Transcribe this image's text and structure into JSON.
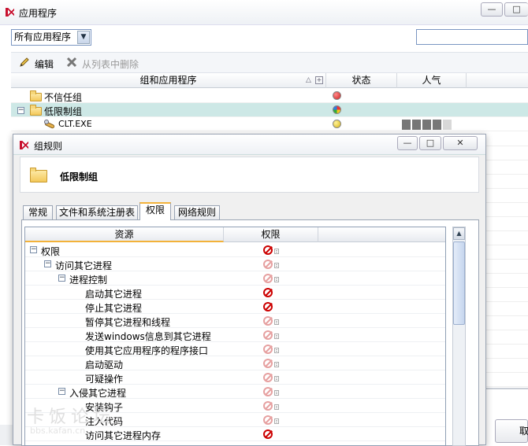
{
  "main": {
    "title": "应用程序",
    "filter_value": "所有应用程序",
    "search_value": "",
    "toolbar": {
      "edit_label": "编辑",
      "delete_label": "从列表中删除"
    },
    "columns": {
      "group_apps": "组和应用程序",
      "status": "状态",
      "popularity": "人气"
    },
    "rows": [
      {
        "label": "不信任组",
        "status_color": "#cc1f1f"
      },
      {
        "label": "低限制组",
        "status_color": "#3aa0e0"
      },
      {
        "label": "CLT.EXE",
        "status_color": "#e0c020",
        "popularity_level": 4,
        "popularity_max": 5
      }
    ],
    "right_button_label": "取"
  },
  "dialog": {
    "title": "组规则",
    "group_name": "低限制组",
    "tabs": [
      "常规",
      "文件和系统注册表",
      "权限",
      "网络规则"
    ],
    "active_tab": "权限",
    "grid_columns": {
      "resource": "资源",
      "permission": "权限"
    },
    "rules": [
      {
        "label": "权限",
        "perm": "deny"
      },
      {
        "label": "访问其它进程",
        "perm": "deny-light"
      },
      {
        "label": "进程控制",
        "perm": "deny-light"
      },
      {
        "label": "启动其它进程",
        "perm": "deny"
      },
      {
        "label": "停止其它进程",
        "perm": "deny"
      },
      {
        "label": "暂停其它进程和线程",
        "perm": "deny-light"
      },
      {
        "label": "发送windows信息到其它进程",
        "perm": "deny-light"
      },
      {
        "label": "使用其它应用程序的程序接口",
        "perm": "deny-light"
      },
      {
        "label": "启动驱动",
        "perm": "deny-light"
      },
      {
        "label": "可疑操作",
        "perm": "deny-light"
      },
      {
        "label": "入侵其它进程",
        "perm": "deny-light"
      },
      {
        "label": "安装钩子",
        "perm": "deny-light"
      },
      {
        "label": "注入代码",
        "perm": "deny-light"
      },
      {
        "label": "访问其它进程内存",
        "perm": "deny"
      }
    ]
  },
  "watermark": {
    "text": "卡饭论坛",
    "url": "bbs.kafan.cn"
  }
}
